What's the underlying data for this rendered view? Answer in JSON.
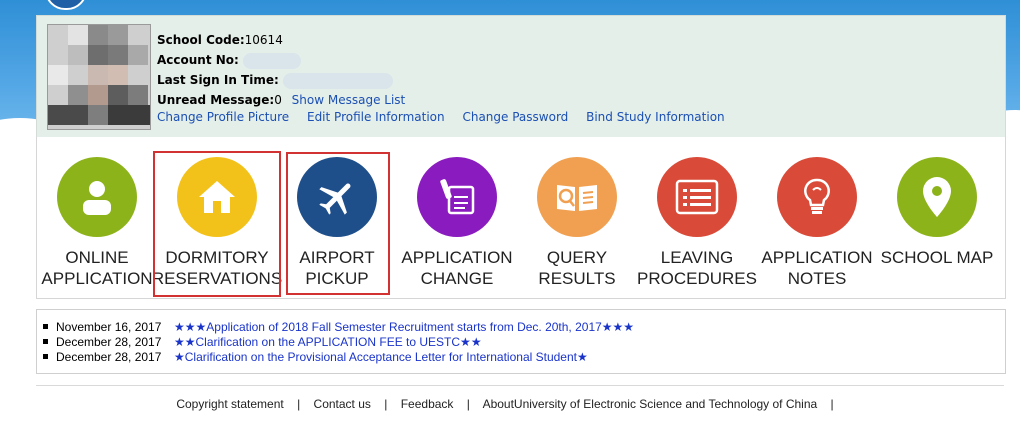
{
  "colors": {
    "link": "#1a4fb3",
    "news_link": "#1a34c9",
    "highlight_box": "#d23232",
    "panel_bg": "#e5efe9"
  },
  "profile": {
    "school_code_label": "School Code:",
    "school_code_value": "10614",
    "account_no_label": "Account No:",
    "last_sign_in_label": "Last Sign In Time:",
    "unread_message_label": "Unread Message:",
    "unread_message_value": "0",
    "show_message_list": "Show Message List",
    "links": [
      "Change Profile Picture",
      "Edit Profile Information",
      "Change Password",
      "Bind Study Information"
    ]
  },
  "services": [
    {
      "line1": "ONLINE",
      "line2": "APPLICATION",
      "icon": "person-icon",
      "color": "#8db31a"
    },
    {
      "line1": "DORMITORY",
      "line2": "RESERVATIONS",
      "icon": "house-icon",
      "color": "#f3c21a"
    },
    {
      "line1": "AIRPORT",
      "line2": "PICKUP",
      "icon": "airplane-icon",
      "color": "#1f4f8a"
    },
    {
      "line1": "APPLICATION",
      "line2": "CHANGE",
      "icon": "edit-document-icon",
      "color": "#8a1bbf"
    },
    {
      "line1": "QUERY",
      "line2": "RESULTS",
      "icon": "book-search-icon",
      "color": "#f0a050"
    },
    {
      "line1": "LEAVING",
      "line2": "PROCEDURES",
      "icon": "list-icon",
      "color": "#d94a38"
    },
    {
      "line1": "APPLICATION",
      "line2": "NOTES",
      "icon": "lightbulb-icon",
      "color": "#d94a38"
    },
    {
      "line1": "SCHOOL MAP",
      "line2": "",
      "icon": "map-pin-icon",
      "color": "#8db31a"
    }
  ],
  "news": [
    {
      "date": "November 16, 2017",
      "title": "★★★Application of 2018 Fall Semester Recruitment starts from Dec. 20th, 2017★★★"
    },
    {
      "date": "December 28, 2017",
      "title": "★★Clarification on the APPLICATION FEE to UESTC★★"
    },
    {
      "date": "December 28, 2017",
      "title": "★Clarification on the Provisional Acceptance Letter for International Student★"
    }
  ],
  "footer": {
    "copyright": "Copyright statement",
    "contact": "Contact us",
    "feedback": "Feedback",
    "about": "AboutUniversity of Electronic Science and Technology of China",
    "separator": "|"
  }
}
